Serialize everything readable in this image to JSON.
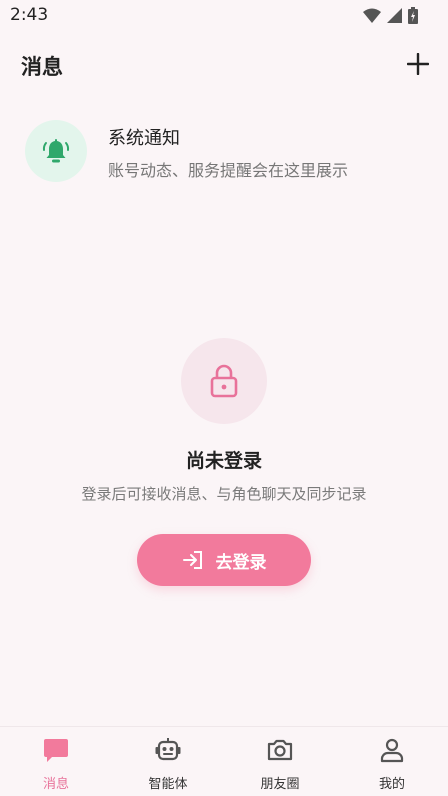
{
  "status_bar": {
    "time": "2:43"
  },
  "header": {
    "title": "消息"
  },
  "system_notice": {
    "title": "系统通知",
    "description": "账号动态、服务提醒会在这里展示"
  },
  "empty_state": {
    "title": "尚未登录",
    "description": "登录后可接收消息、与角色聊天及同步记录",
    "login_label": "去登录"
  },
  "bottom_nav": {
    "items": [
      {
        "label": "消息",
        "icon": "chat-bubble-icon",
        "active": true
      },
      {
        "label": "智能体",
        "icon": "robot-icon",
        "active": false
      },
      {
        "label": "朋友圈",
        "icon": "camera-icon",
        "active": false
      },
      {
        "label": "我的",
        "icon": "person-icon",
        "active": false
      }
    ]
  },
  "colors": {
    "background": "#FBF5F7",
    "accent": "#F27A9C",
    "active_tab": "#E8729A",
    "notice_green": "#2FA86B",
    "notice_bg": "#E3F5EC"
  }
}
